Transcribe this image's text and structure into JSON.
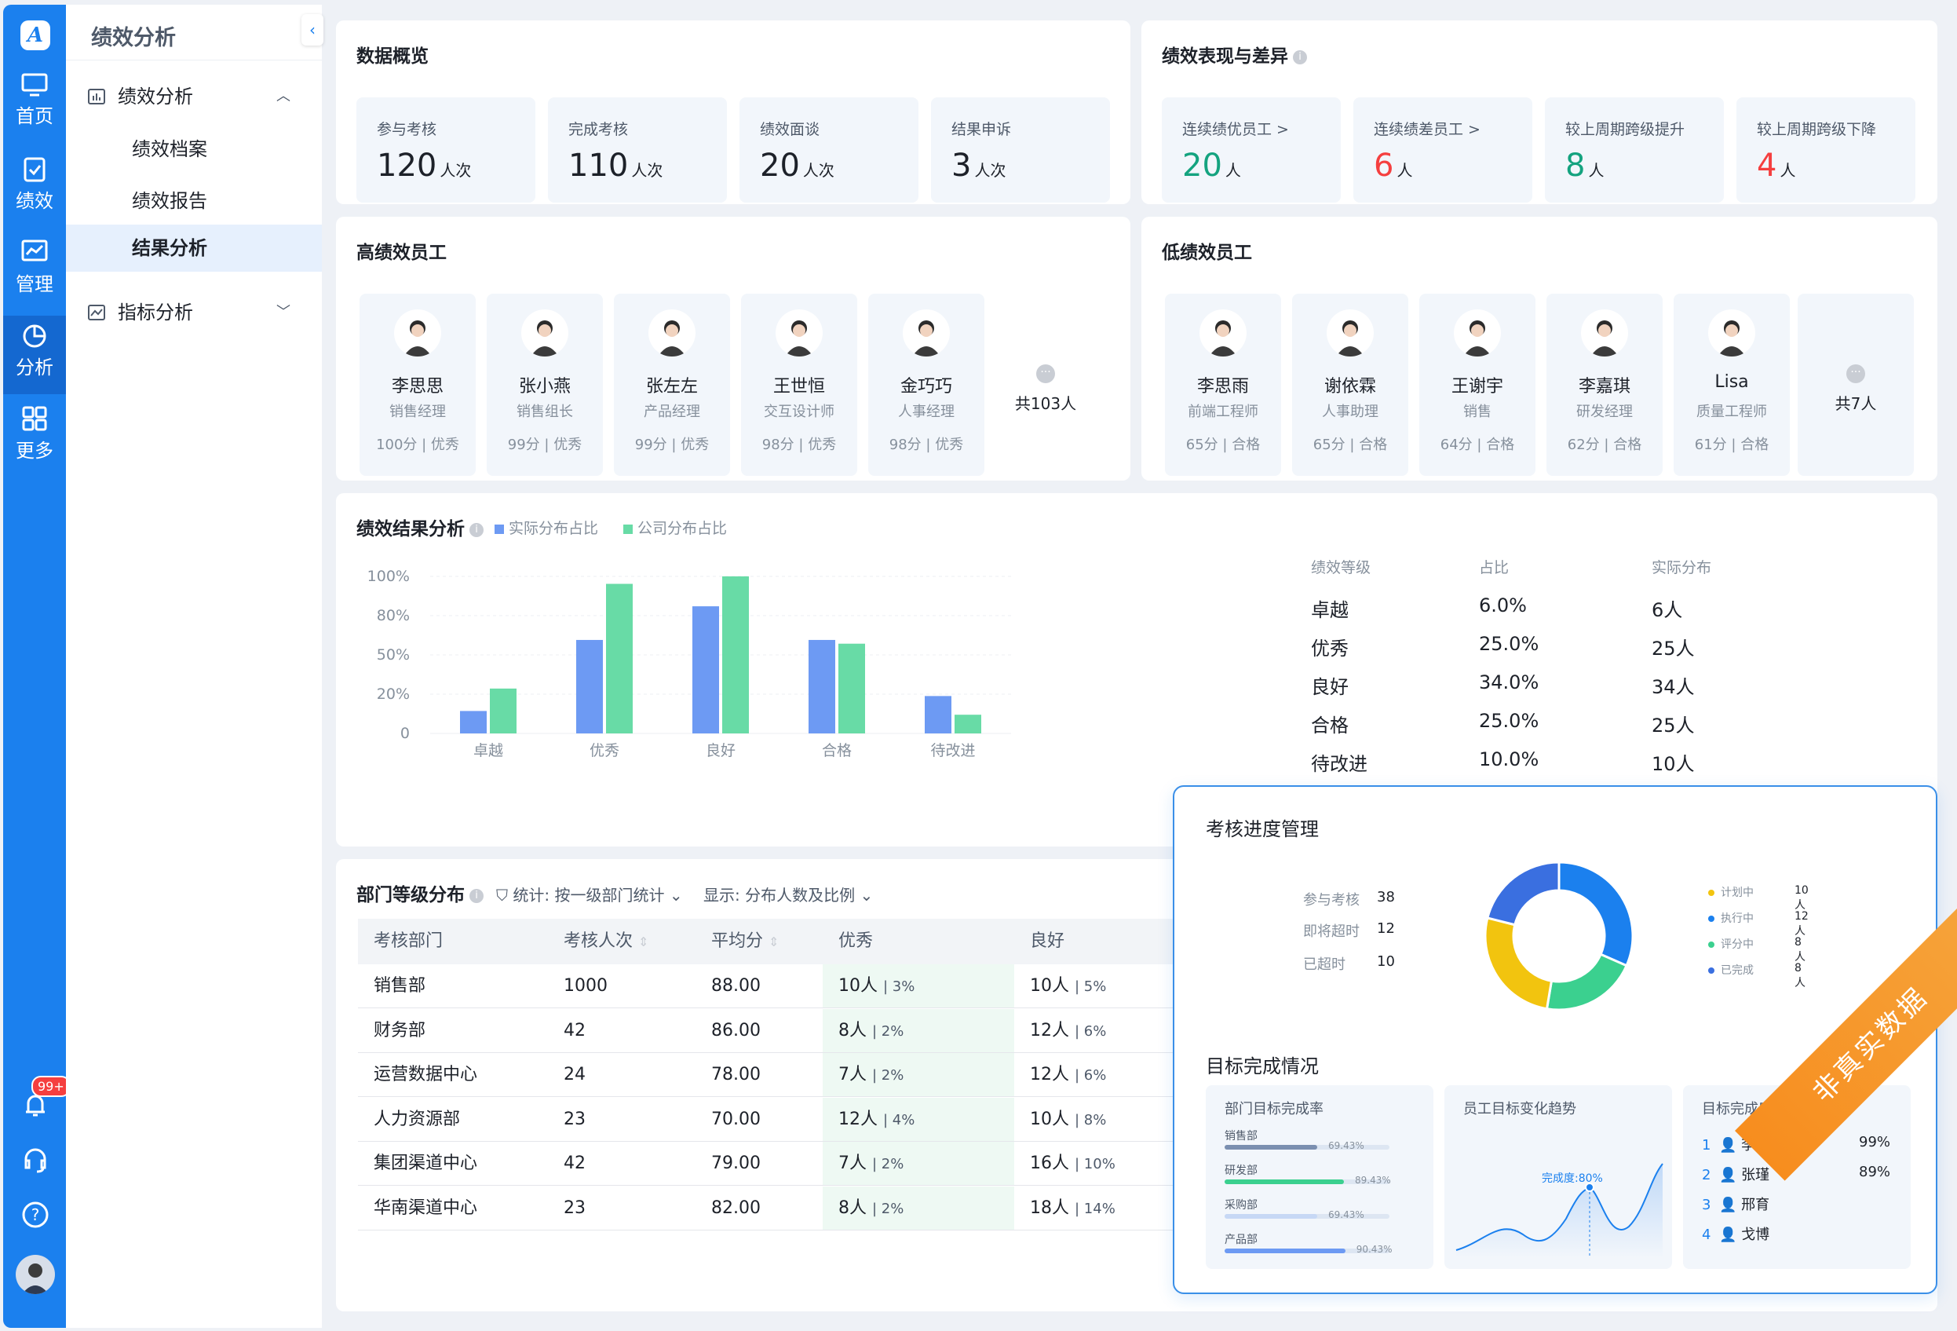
{
  "rail": {
    "items": [
      {
        "label": "首页"
      },
      {
        "label": "绩效"
      },
      {
        "label": "管理"
      },
      {
        "label": "分析"
      },
      {
        "label": "更多"
      }
    ],
    "notification_count": "99+"
  },
  "sidebar": {
    "title": "绩效分析",
    "groups": [
      {
        "label": "绩效分析",
        "children": [
          "绩效档案",
          "绩效报告",
          "结果分析"
        ]
      },
      {
        "label": "指标分析"
      }
    ],
    "active": "结果分析"
  },
  "overview": {
    "title": "数据概览",
    "stats": [
      {
        "label": "参与考核",
        "value": "120",
        "unit": "人次"
      },
      {
        "label": "完成考核",
        "value": "110",
        "unit": "人次"
      },
      {
        "label": "绩效面谈",
        "value": "20",
        "unit": "人次"
      },
      {
        "label": "结果申诉",
        "value": "3",
        "unit": "人次"
      }
    ]
  },
  "diff": {
    "title": "绩效表现与差异",
    "stats": [
      {
        "label": "连续绩优员工 >",
        "value": "20",
        "unit": "人",
        "color": "#14a37f"
      },
      {
        "label": "连续绩差员工 >",
        "value": "6",
        "unit": "人",
        "color": "#f53f3f"
      },
      {
        "label": "较上周期跨级提升",
        "value": "8",
        "unit": "人",
        "color": "#14a37f"
      },
      {
        "label": "较上周期跨级下降",
        "value": "4",
        "unit": "人",
        "color": "#f53f3f"
      }
    ]
  },
  "high": {
    "title": "高绩效员工",
    "employees": [
      {
        "name": "李思思",
        "role": "销售经理",
        "score": "100分 | 优秀"
      },
      {
        "name": "张小燕",
        "role": "销售组长",
        "score": "99分 | 优秀"
      },
      {
        "name": "张左左",
        "role": "产品经理",
        "score": "99分 | 优秀"
      },
      {
        "name": "王世恒",
        "role": "交互设计师",
        "score": "98分 | 优秀"
      },
      {
        "name": "金巧巧",
        "role": "人事经理",
        "score": "98分 | 优秀"
      }
    ],
    "total": "共103人"
  },
  "low": {
    "title": "低绩效员工",
    "employees": [
      {
        "name": "李思雨",
        "role": "前端工程师",
        "score": "65分 | 合格"
      },
      {
        "name": "谢依霖",
        "role": "人事助理",
        "score": "65分 | 合格"
      },
      {
        "name": "王谢宇",
        "role": "销售",
        "score": "64分 | 合格"
      },
      {
        "name": "李嘉琪",
        "role": "研发经理",
        "score": "62分 | 合格"
      },
      {
        "name": "Lisa",
        "role": "质量工程师",
        "score": "61分 | 合格"
      }
    ],
    "total": "共7人"
  },
  "result": {
    "title": "绩效结果分析",
    "legend_actual": "实际分布占比",
    "legend_company": "公司分布占比",
    "colors": {
      "actual": "#6d9af3",
      "company": "#68dba6"
    },
    "table_headers": [
      "绩效等级",
      "占比",
      "实际分布"
    ],
    "table_rows": [
      [
        "卓越",
        "6.0%",
        "6人"
      ],
      [
        "优秀",
        "25.0%",
        "25人"
      ],
      [
        "良好",
        "34.0%",
        "34人"
      ],
      [
        "合格",
        "25.0%",
        "25人"
      ],
      [
        "待改进",
        "10.0%",
        "10人"
      ]
    ]
  },
  "chart_data": {
    "type": "bar",
    "categories": [
      "卓越",
      "优秀",
      "良好",
      "合格",
      "待改进"
    ],
    "y_ticks": [
      "100%",
      "80%",
      "50%",
      "20%",
      "0"
    ],
    "series": [
      {
        "name": "实际分布占比",
        "values": [
          6,
          25,
          34,
          25,
          10
        ]
      },
      {
        "name": "公司分布占比",
        "values": [
          12,
          40,
          42,
          24,
          5
        ]
      }
    ],
    "ylim": [
      0,
      42
    ],
    "grid": true
  },
  "dept": {
    "title": "部门等级分布",
    "filter_stat": "统计: 按一级部门统计",
    "filter_show": "显示: 分布人数及比例",
    "headers": [
      "考核部门",
      "考核人次",
      "平均分",
      "优秀",
      "良好"
    ],
    "rows": [
      {
        "dept": "销售部",
        "count": "1000",
        "avg": "88.00",
        "ex": "10人",
        "ex_p": "3%",
        "good": "10人",
        "good_p": "5%"
      },
      {
        "dept": "财务部",
        "count": "42",
        "avg": "86.00",
        "ex": "8人",
        "ex_p": "2%",
        "good": "12人",
        "good_p": "6%"
      },
      {
        "dept": "运营数据中心",
        "count": "24",
        "avg": "78.00",
        "ex": "7人",
        "ex_p": "2%",
        "good": "12人",
        "good_p": "6%"
      },
      {
        "dept": "人力资源部",
        "count": "23",
        "avg": "70.00",
        "ex": "12人",
        "ex_p": "4%",
        "good": "10人",
        "good_p": "8%"
      },
      {
        "dept": "集团渠道中心",
        "count": "42",
        "avg": "79.00",
        "ex": "7人",
        "ex_p": "2%",
        "good": "16人",
        "good_p": "10%"
      },
      {
        "dept": "华南渠道中心",
        "count": "23",
        "avg": "82.00",
        "ex": "8人",
        "ex_p": "2%",
        "good": "18人",
        "good_p": "14%"
      }
    ]
  },
  "popup": {
    "title": "考核进度管理",
    "kv": [
      {
        "k": "参与考核",
        "v": "38"
      },
      {
        "k": "即将超时",
        "v": "12"
      },
      {
        "k": "已超时",
        "v": "10"
      }
    ],
    "donut": [
      {
        "label": "计划中",
        "value": "10人",
        "n": 10,
        "color": "#f2c40f"
      },
      {
        "label": "执行中",
        "value": "12人",
        "n": 12,
        "color": "#1b80ee"
      },
      {
        "label": "评分中",
        "value": "8人",
        "n": 8,
        "color": "#3bd08f"
      },
      {
        "label": "已完成",
        "value": "8人",
        "n": 8,
        "color": "#3a6fe0"
      }
    ],
    "goal_title": "目标完成情况",
    "dept_rate": {
      "title": "部门目标完成率",
      "items": [
        {
          "name": "销售部",
          "pct": "69.43%",
          "v": 0.6943,
          "color": "#7b8fb0"
        },
        {
          "name": "研发部",
          "pct": "89.43%",
          "v": 0.8943,
          "color": "#3bd08f"
        },
        {
          "name": "采购部",
          "pct": "69.43%",
          "v": 0.6943,
          "color": "#c7d8f5"
        },
        {
          "name": "产品部",
          "pct": "90.43%",
          "v": 0.9043,
          "color": "#6d9af3"
        }
      ]
    },
    "trend": {
      "title": "员工目标变化趋势",
      "label": "完成度:80%"
    },
    "ranking": {
      "title": "目标完成度排名",
      "items": [
        {
          "n": "1",
          "name": "李明震",
          "p": "99%"
        },
        {
          "n": "2",
          "name": "张瑾",
          "p": "89%"
        },
        {
          "n": "3",
          "name": "邢育",
          "p": ""
        },
        {
          "n": "4",
          "name": "戈博",
          "p": ""
        }
      ]
    }
  },
  "watermark": "非真实数据"
}
